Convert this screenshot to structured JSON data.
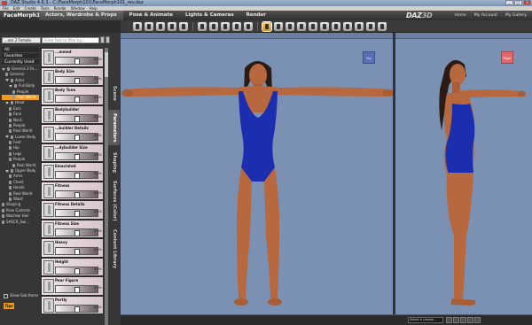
{
  "window": {
    "title": "DAZ Studio 4.6.3 - C:\\FaceMorph101\\FaceMorph101_rev.daz",
    "min_label": "_",
    "max_label": "□",
    "close_label": "x"
  },
  "menu": [
    "File",
    "Edit",
    "Create",
    "Tools",
    "Render",
    "Window",
    "Help"
  ],
  "header": {
    "doc_name": "FaceMorph101",
    "rooms": [
      "Actors, Wardrobe & Props",
      "Pose & Animate",
      "Lights & Cameras",
      "Render"
    ],
    "brand_daz": "DAZ",
    "brand_3d": "3D",
    "links": [
      "Home",
      "My Account",
      "My Gallery"
    ]
  },
  "left_panel": {
    "preset_select": "...ess 2 Female",
    "filter_placeholder": "Enter text to filter by...",
    "categories": [
      "All",
      "Favorites",
      "Currently Used"
    ],
    "tree": [
      {
        "label": "Genesis 2 Fe...",
        "indent": 0,
        "expanded": true
      },
      {
        "label": "General",
        "indent": 1
      },
      {
        "label": "Actor",
        "indent": 1,
        "expanded": true
      },
      {
        "label": "Full Body",
        "indent": 2,
        "expanded": true
      },
      {
        "label": "People",
        "indent": 3
      },
      {
        "label": "Real World",
        "indent": 3,
        "selected": true
      },
      {
        "label": "Head",
        "indent": 1,
        "expanded": true
      },
      {
        "label": "Ears",
        "indent": 2
      },
      {
        "label": "Face",
        "indent": 2
      },
      {
        "label": "Neck",
        "indent": 2
      },
      {
        "label": "People",
        "indent": 2
      },
      {
        "label": "Real World",
        "indent": 2
      },
      {
        "label": "Lower Body",
        "indent": 1,
        "expanded": true
      },
      {
        "label": "Feet",
        "indent": 2
      },
      {
        "label": "Hip",
        "indent": 2
      },
      {
        "label": "Legs",
        "indent": 2
      },
      {
        "label": "People",
        "indent": 2
      },
      {
        "label": "Real World",
        "indent": 3
      },
      {
        "label": "Upper Body",
        "indent": 1,
        "expanded": true
      },
      {
        "label": "Arms",
        "indent": 2
      },
      {
        "label": "Chest",
        "indent": 2
      },
      {
        "label": "Hands",
        "indent": 2
      },
      {
        "label": "Real World",
        "indent": 2
      },
      {
        "label": "Waist",
        "indent": 2
      },
      {
        "label": "Shaping",
        "indent": 0
      },
      {
        "label": "Pose Controls",
        "indent": 0
      },
      {
        "label": "Wachiwi Hair",
        "indent": 0
      },
      {
        "label": "SASCR_Swi...",
        "indent": 0
      }
    ],
    "sliders": [
      {
        "label": "...mmed",
        "value": "0.0%"
      },
      {
        "label": "Body Size",
        "value": "0.0%"
      },
      {
        "label": "Body Tone",
        "value": "0.0%"
      },
      {
        "label": "Bodybuilder",
        "value": "0.0%"
      },
      {
        "label": "...builder Details",
        "value": "0.0%"
      },
      {
        "label": "...dybuilder Size",
        "value": "0.0%"
      },
      {
        "label": "Emaciated",
        "value": "0.0%"
      },
      {
        "label": "Fitness",
        "value": "0.0%"
      },
      {
        "label": "Fitness Details",
        "value": "0.0%"
      },
      {
        "label": "Fitness Size",
        "value": "0.0%"
      },
      {
        "label": "Heavy",
        "value": "0.0%"
      },
      {
        "label": "Height",
        "value": "0.0%"
      },
      {
        "label": "Pear Figure",
        "value": "0.0%"
      },
      {
        "label": "Portly",
        "value": "0.0%"
      }
    ],
    "show_sub_items": "Show Sub Items",
    "tips": "Tips"
  },
  "vertical_tabs": [
    "Scene",
    "Parameters",
    "Shaping",
    "Surfaces (Color)",
    "Content Library"
  ],
  "viewports": {
    "front_cube_label": "Top",
    "side_cube_label": "Right"
  },
  "status": {
    "lesson_select": "Select a Lesson..."
  },
  "colors": {
    "viewport_bg": "#7b91b4",
    "swimsuit": "#1b2eb0",
    "skin": "#b8683e",
    "selection": "#f29b1b"
  }
}
